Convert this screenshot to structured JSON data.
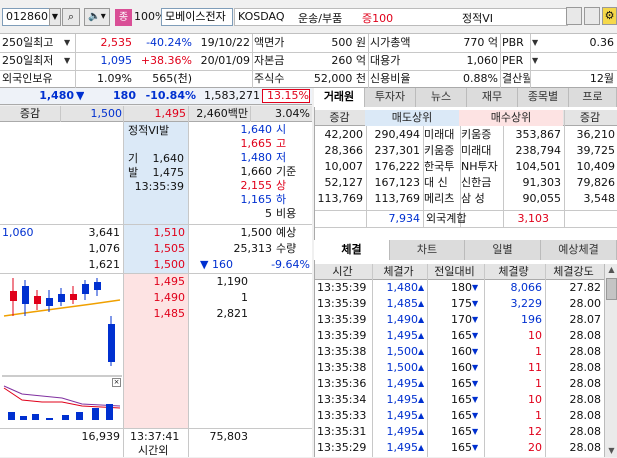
{
  "toolbar": {
    "code": "012860",
    "zoom": "100%",
    "name": "모베이스전자",
    "market": "KOSDAQ",
    "sector": "운송/부품",
    "margin": "증100",
    "status": "정적VI",
    "badge": "종"
  },
  "info": {
    "rows": [
      {
        "l1": "250일최고",
        "v1": "2,535",
        "p1": "-40.24%",
        "d1": "19/10/22",
        "l2": "액면가",
        "v2": "500 원",
        "l3": "시가총액",
        "v3": "770 억",
        "l4": "PBR",
        "v4": "0.36"
      },
      {
        "l1": "250일최저",
        "v1": "1,095",
        "p1": "+38.36%",
        "d1": "20/01/09",
        "l2": "자본금",
        "v2": "260 억",
        "l3": "대용가",
        "v3": "1,060",
        "l4": "PER",
        "v4": ""
      },
      {
        "l1": "외국인보유",
        "v1": "1.09%",
        "p1": "565(천)",
        "d1": "",
        "l2": "주식수",
        "v2": "52,000 천",
        "l3": "신용비율",
        "v3": "0.88%",
        "l4": "결산월",
        "v4": "12월"
      }
    ]
  },
  "quote": {
    "price": "1,480",
    "arrow": "▼",
    "change": "180",
    "rate": "-10.84%",
    "volume": "1,583,271",
    "vrate": "13.15%",
    "vtrend": "↑"
  },
  "orderbook": {
    "hdr": [
      "증감",
      "1,500",
      "1,495",
      "2,460백만",
      "3.04%"
    ],
    "sell_qty": [
      "1,640",
      "1,665",
      "1,480",
      "1,660",
      "2,155",
      "1,165",
      "5"
    ],
    "sell_lbl": [
      "시",
      "고",
      "저",
      "기준",
      "상",
      "하",
      "비용"
    ],
    "vi_label": "정적VI발",
    "vi": [
      {
        "k": "기",
        "v": "1,640"
      },
      {
        "k": "발",
        "v": "1,475"
      },
      {
        "k": "",
        "v": "13:35:39"
      }
    ],
    "mid": [
      {
        "a": "1,060",
        "b": "3,641",
        "c": "1,510",
        "d": "1,500",
        "e": "예상"
      },
      {
        "a": "",
        "b": "1,076",
        "c": "1,505",
        "d": "25,313",
        "e": "수량"
      },
      {
        "a": "",
        "b": "1,621",
        "c": "1,500",
        "d": "▼ 160",
        "e": "-9.64%"
      }
    ],
    "buy": [
      {
        "p": "1,495",
        "q": "1,190"
      },
      {
        "p": "1,490",
        "q": "1"
      },
      {
        "p": "1,485",
        "q": "2,821"
      }
    ],
    "total_sell": "16,939",
    "time": "13:37:41",
    "total_buy": "75,803",
    "after": "시간외"
  },
  "broker": {
    "tabs": [
      "거래원",
      "투자자",
      "뉴스",
      "재무",
      "종목별",
      "프로"
    ],
    "hdr": [
      "증감",
      "매도상위",
      "매수상위",
      "증감"
    ],
    "rows": [
      [
        "42,200",
        "290,494",
        "미래대",
        "키움증",
        "353,867",
        "36,210"
      ],
      [
        "28,366",
        "237,301",
        "키움증",
        "미래대",
        "238,794",
        "39,725"
      ],
      [
        "10,007",
        "176,222",
        "한국투",
        "NH투자",
        "104,501",
        "10,409"
      ],
      [
        "52,127",
        "167,123",
        "대 신",
        "신한금",
        "91,303",
        "79,826"
      ],
      [
        "113,769",
        "113,769",
        "메리츠",
        "삼 성",
        "90,055",
        "3,548"
      ]
    ],
    "foreign_label": "외국계합",
    "foreign_sell": "7,934",
    "foreign_buy": "3,103"
  },
  "trades": {
    "tabs": [
      "체결",
      "차트",
      "일별",
      "예상체결"
    ],
    "hdr": [
      "시간",
      "체결가",
      "전일대비",
      "체결량",
      "체결강도"
    ],
    "rows": [
      [
        "13:35:39",
        "1,480",
        "180",
        "8,066",
        "27.82"
      ],
      [
        "13:35:39",
        "1,485",
        "175",
        "3,229",
        "28.00"
      ],
      [
        "13:35:39",
        "1,490",
        "170",
        "196",
        "28.07"
      ],
      [
        "13:35:39",
        "1,495",
        "165",
        "10",
        "28.08"
      ],
      [
        "13:35:38",
        "1,500",
        "160",
        "1",
        "28.08"
      ],
      [
        "13:35:38",
        "1,500",
        "160",
        "11",
        "28.08"
      ],
      [
        "13:35:36",
        "1,495",
        "165",
        "1",
        "28.08"
      ],
      [
        "13:35:34",
        "1,495",
        "165",
        "10",
        "28.08"
      ],
      [
        "13:35:33",
        "1,495",
        "165",
        "1",
        "28.08"
      ],
      [
        "13:35:31",
        "1,495",
        "165",
        "12",
        "28.08"
      ],
      [
        "13:35:29",
        "1,495",
        "165",
        "20",
        "28.08"
      ]
    ]
  },
  "colors": {
    "up": "#e0001a",
    "down": "#0030d0",
    "sell_bg": "#dbe9f7",
    "buy_bg": "#fde3e3"
  }
}
